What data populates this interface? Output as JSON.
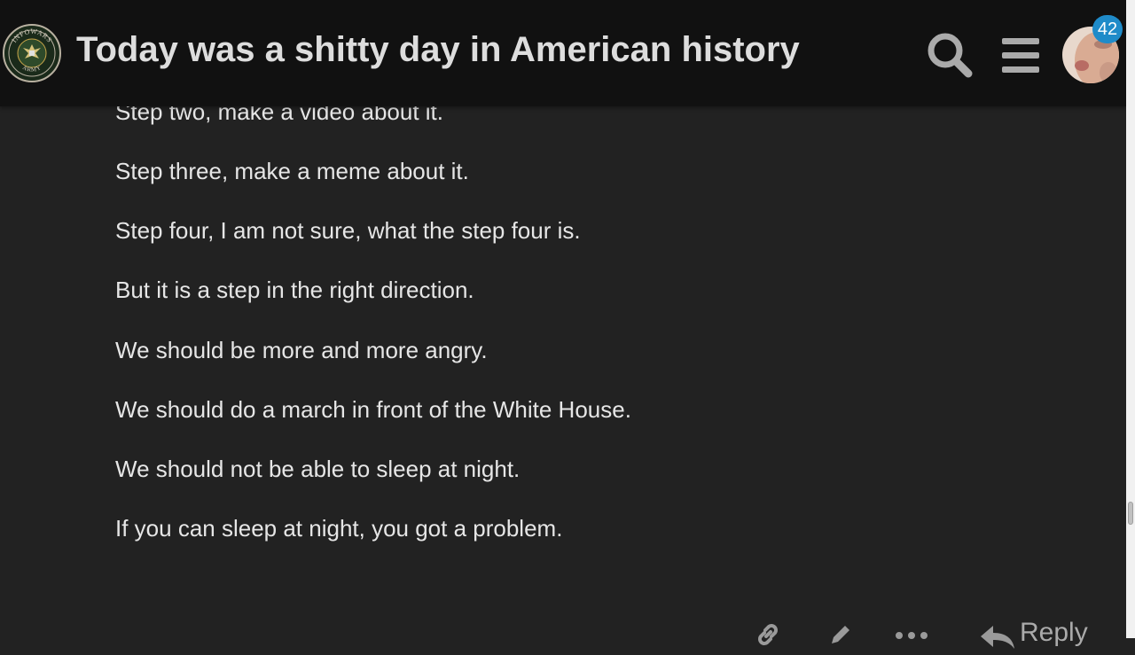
{
  "header": {
    "title": "Today was a shitty day in American history",
    "logo": {
      "icon": "infowars-army-seal-icon",
      "arc_top": "INFOWARS",
      "arc_bottom": "ARMY"
    },
    "search_icon": "search-icon",
    "menu_icon": "hamburger-menu-icon",
    "notification_count": "42",
    "colors": {
      "background": "#111111",
      "title": "#dddddd",
      "badge": "#1f8bc9"
    }
  },
  "post": {
    "lines": [
      "Step two, make a video about it.",
      "Step three, make a meme about it.",
      "Step four, I am not sure, what the step four is.",
      "But it is a step in the right direction.",
      "We should be more and more angry.",
      "We should do a march in front of the White House.",
      "We should not be able to sleep at night.",
      "If you can sleep at night, you got a problem."
    ],
    "text_color": "#e6e6e6",
    "background": "#222222"
  },
  "controls": {
    "reply_label": "Reply",
    "icons": [
      "link-icon",
      "edit-icon",
      "more-icon",
      "reply-icon"
    ]
  }
}
